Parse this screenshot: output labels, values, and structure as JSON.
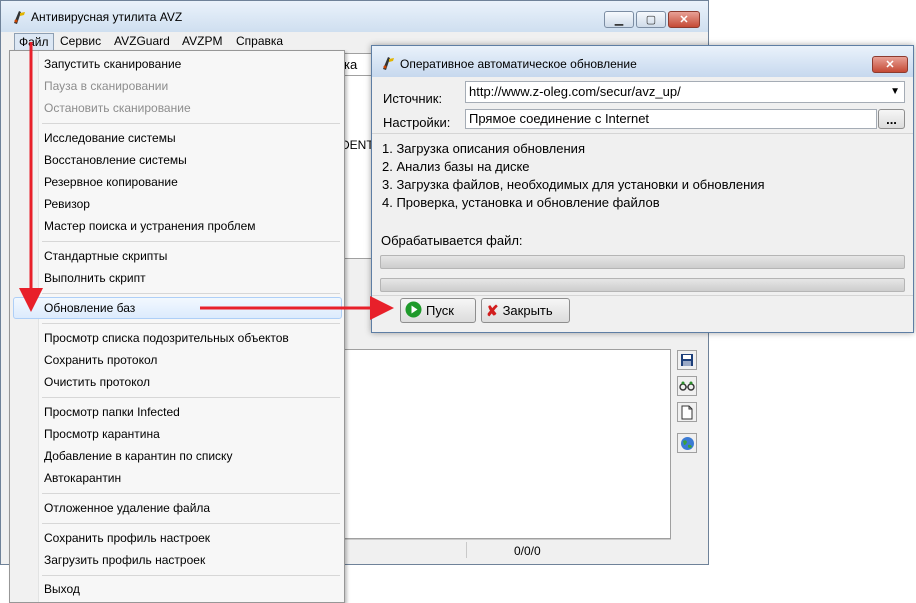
{
  "main_window": {
    "title": "Антивирусная утилита AVZ",
    "tab_fragment": "ка",
    "content_fragment": "DENT",
    "status_counter": "0/0/0",
    "menu": [
      {
        "label": "Файл"
      },
      {
        "label": "Сервис"
      },
      {
        "label": "AVZGuard"
      },
      {
        "label": "AVZPM"
      },
      {
        "label": "Справка"
      }
    ]
  },
  "file_menu": {
    "groups": [
      [
        {
          "label": "Запустить сканирование",
          "enabled": true
        },
        {
          "label": "Пауза в сканировании",
          "enabled": false
        },
        {
          "label": "Остановить сканирование",
          "enabled": false
        }
      ],
      [
        {
          "label": "Исследование системы",
          "enabled": true
        },
        {
          "label": "Восстановление системы",
          "enabled": true
        },
        {
          "label": "Резервное копирование",
          "enabled": true
        },
        {
          "label": "Ревизор",
          "enabled": true
        },
        {
          "label": "Мастер поиска и устранения проблем",
          "enabled": true
        }
      ],
      [
        {
          "label": "Стандартные скрипты",
          "enabled": true
        },
        {
          "label": "Выполнить скрипт",
          "enabled": true
        }
      ],
      [
        {
          "label": "Обновление баз",
          "enabled": true,
          "highlighted": true
        }
      ],
      [
        {
          "label": "Просмотр списка подозрительных объектов",
          "enabled": true
        },
        {
          "label": "Сохранить протокол",
          "enabled": true
        },
        {
          "label": "Очистить протокол",
          "enabled": true
        }
      ],
      [
        {
          "label": "Просмотр папки Infected",
          "enabled": true
        },
        {
          "label": "Просмотр карантина",
          "enabled": true
        },
        {
          "label": "Добавление в карантин по списку",
          "enabled": true
        },
        {
          "label": "Автокарантин",
          "enabled": true
        }
      ],
      [
        {
          "label": "Отложенное удаление файла",
          "enabled": true
        }
      ],
      [
        {
          "label": "Сохранить профиль настроек",
          "enabled": true
        },
        {
          "label": "Загрузить профиль настроек",
          "enabled": true
        }
      ],
      [
        {
          "label": "Выход",
          "enabled": true
        }
      ]
    ]
  },
  "dialog": {
    "title": "Оперативное автоматическое обновление",
    "source_label": "Источник:",
    "source_value": "http://www.z-oleg.com/secur/avz_up/",
    "settings_label": "Настройки:",
    "settings_value": "Прямое соединение с Internet",
    "settings_button": "...",
    "steps": [
      "1. Загрузка описания обновления",
      "2. Анализ базы на диске",
      "3. Загрузка файлов, необходимых для установки и обновления",
      "4. Проверка, установка и обновление файлов"
    ],
    "processing_label": "Обрабатывается файл:",
    "progress": [
      0,
      0
    ],
    "start_button": "Пуск",
    "close_button": "Закрыть"
  },
  "colors": {
    "annotation_arrow": "#e8202a",
    "menu_highlight": "#dcebfd",
    "title_bar": "#cfdff0"
  },
  "icons": [
    "app-icon",
    "minimize-icon",
    "maximize-icon",
    "close-icon",
    "dropdown-arrow-icon",
    "play-icon",
    "close-x-icon",
    "save-icon",
    "glasses-icon",
    "new-document-icon",
    "globe-icon"
  ]
}
